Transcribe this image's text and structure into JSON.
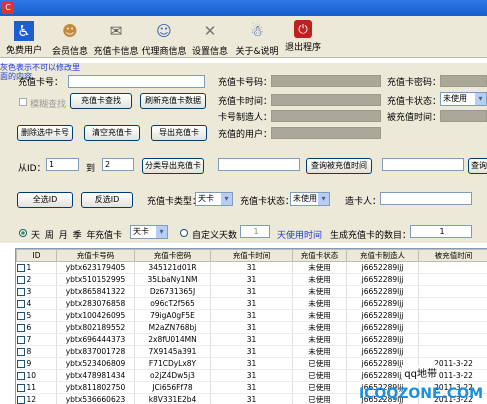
{
  "toolbar": {
    "items": [
      {
        "label": "免费用户",
        "icon": "user-icon"
      },
      {
        "label": "会员信息",
        "icon": "member-icon"
      },
      {
        "label": "充值卡信息",
        "icon": "card-icon"
      },
      {
        "label": "代理商信息",
        "icon": "agent-icon"
      },
      {
        "label": "设置信息",
        "icon": "tools-icon"
      },
      {
        "label": "关于&说明",
        "icon": "info-icon"
      },
      {
        "label": "退出程序",
        "icon": "power-icon"
      }
    ]
  },
  "search": {
    "card_no_label": "充值卡号：",
    "fuzzy_label": "模糊查找",
    "find_button": "充值卡查找",
    "refresh_button": "刷新充值卡数据",
    "delete_button": "删除选中卡号",
    "clear_button": "清空充值卡",
    "export_button": "导出充值卡"
  },
  "details": {
    "card_no": "充值卡号码：",
    "password": "充值卡密码：",
    "time": "充值卡时间：",
    "status": "充值卡状态：",
    "status_value": "未使用",
    "maker": "卡号制造人：",
    "used_time": "被充值时间：",
    "user": "充值的用户：",
    "gray_note": "灰色表示不可以修改里面的内容"
  },
  "range": {
    "from_label": "从ID：",
    "from_value": "1",
    "to_label": "到",
    "to_value": "2",
    "export_button": "分类导出充值卡",
    "query_used_time": "查询被充值时间",
    "query_more": "查询"
  },
  "filters": {
    "select_all": "全选ID",
    "invert": "反选ID",
    "type_label": "充值卡类型：",
    "type_value": "天卡",
    "status_label": "充值卡状态：",
    "status_value": "未使用",
    "maker_label": "造卡人：",
    "maker_value": ""
  },
  "generate": {
    "units": "天 周 月 季 年",
    "kind_label": "充值卡",
    "kind_value": "天卡",
    "custom_days_label": "自定义天数",
    "custom_days_value": "1",
    "days_unit": "天使用时间",
    "count_label": "生成充值卡的数目：",
    "count_value": "1"
  },
  "table": {
    "headers": [
      "ID",
      "充值卡号码",
      "充值卡密码",
      "充值卡时间",
      "充值卡状态",
      "充值卡制造人",
      "被充值时间"
    ],
    "rows": [
      [
        "1",
        "ybtx623179405",
        "345121d01R",
        "31",
        "未使用",
        "j6652289ljj",
        ""
      ],
      [
        "2",
        "ybtx510152995",
        "35LbaNy1NM",
        "31",
        "未使用",
        "j6652289ljj",
        ""
      ],
      [
        "3",
        "ybtx865841322",
        "Dz6731365J",
        "31",
        "未使用",
        "j6652289ljj",
        ""
      ],
      [
        "4",
        "ybtx283076858",
        "o96cT2f565",
        "31",
        "未使用",
        "j6652289ljj",
        ""
      ],
      [
        "5",
        "ybtx100426095",
        "79igA0gF5E",
        "31",
        "未使用",
        "j6652289ljj",
        ""
      ],
      [
        "6",
        "ybtx802189552",
        "M2aZN768bj",
        "31",
        "未使用",
        "j6652289ljj",
        ""
      ],
      [
        "7",
        "ybtx696444373",
        "2x8fU014MN",
        "31",
        "未使用",
        "j6652289ljj",
        ""
      ],
      [
        "8",
        "ybtx837001728",
        "7X9145a391",
        "31",
        "未使用",
        "j6652289ljj",
        ""
      ],
      [
        "9",
        "ybtx523406809",
        "F71CDyLx8Y",
        "31",
        "已使用",
        "j6652289ljj",
        "2011-3-22"
      ],
      [
        "10",
        "ybtx478981434",
        "o2jZ4Dw5j3",
        "31",
        "已使用",
        "j6652289ljj",
        "2011-3-22"
      ],
      [
        "11",
        "ybtx811802750",
        "JCi656Ff78",
        "31",
        "已使用",
        "j6652289ljj",
        "2011-3-22"
      ],
      [
        "12",
        "ybtx536660623",
        "k8V331E2b4",
        "31",
        "已使用",
        "j6652289ljj",
        "2011-3-22"
      ]
    ]
  },
  "watermark": {
    "small": "qq地带",
    "big": "ICQQZONE.COM"
  }
}
